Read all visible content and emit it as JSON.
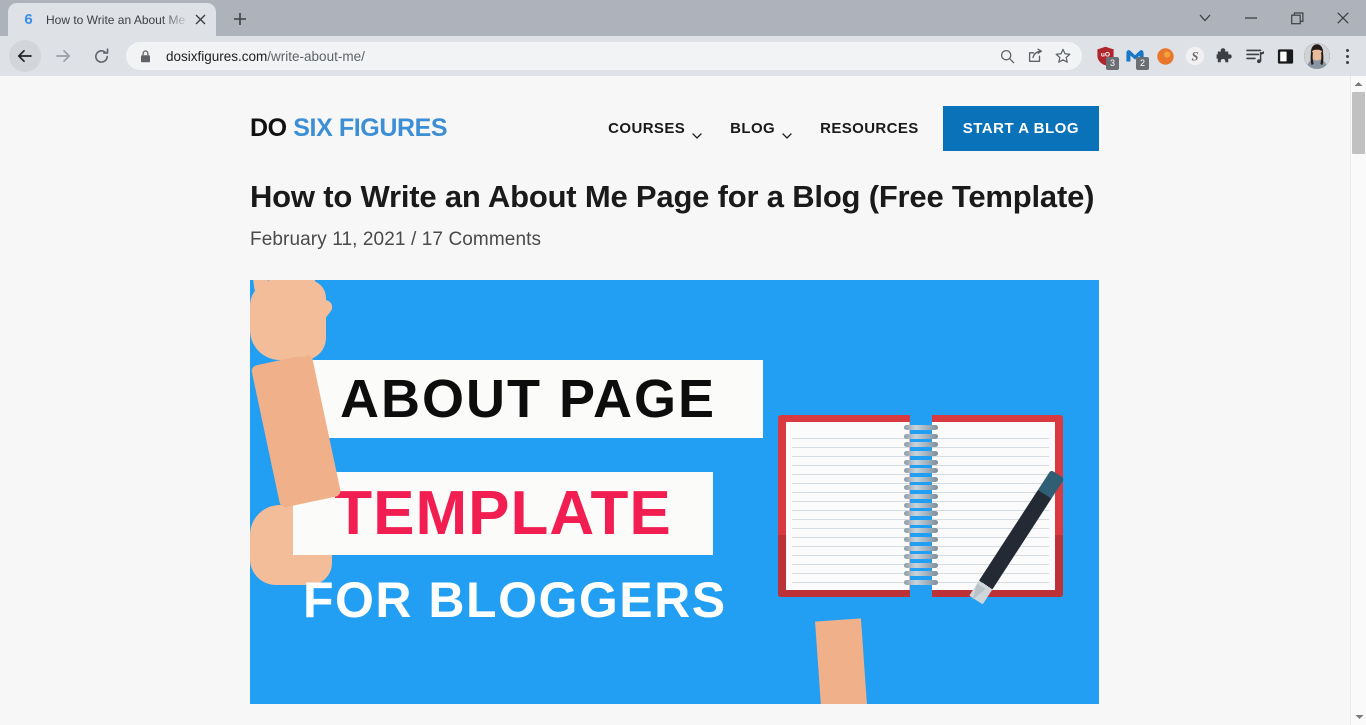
{
  "browser": {
    "tab": {
      "favicon_text": "6",
      "title": "How to Write an About Me Page",
      "close_label": "✕"
    },
    "new_tab_label": "+",
    "window_controls": {
      "tab_search": "tab-search-chevron",
      "minimize": "—",
      "maximize": "maximize-square",
      "close": "✕"
    },
    "nav": {
      "back": "back-arrow",
      "forward": "forward-arrow",
      "reload": "reload-arrow"
    },
    "omnibox": {
      "lock": "site-lock",
      "url_domain": "dosixfigures.com",
      "url_path": "/write-about-me/",
      "search_icon": "search-magnifier",
      "share_icon": "share-arrow",
      "bookmark_icon": "bookmark-star"
    },
    "extensions": [
      {
        "name": "ublock-origin",
        "glyph": "uO",
        "badge": "3",
        "color": "#b1262c"
      },
      {
        "name": "malwarebytes",
        "glyph": "M",
        "badge": "2",
        "color": "#1877c9"
      },
      {
        "name": "orange-dot-extension",
        "glyph": "",
        "badge": "",
        "color": "#e8762c"
      },
      {
        "name": "s-extension",
        "glyph": "S",
        "badge": "",
        "color": "#6b6b6b"
      },
      {
        "name": "extensions-puzzle",
        "glyph": "",
        "badge": "",
        "color": "#3c4043"
      },
      {
        "name": "reading-list",
        "glyph": "",
        "badge": "",
        "color": "#3c4043"
      },
      {
        "name": "side-panel",
        "glyph": "",
        "badge": "",
        "color": "#1a1a1a"
      }
    ],
    "profile": {
      "name": "profile-avatar"
    },
    "menu": "chrome-menu-dots"
  },
  "site": {
    "logo": {
      "part1": "DO",
      "part2": "SIX FIGURES"
    },
    "nav_items": [
      {
        "label": "COURSES",
        "has_chevron": true
      },
      {
        "label": "BLOG",
        "has_chevron": true
      },
      {
        "label": "RESOURCES",
        "has_chevron": false
      }
    ],
    "cta_label": "START A BLOG",
    "cta_color": "#0a72b9",
    "post": {
      "title": "How to Write an About Me Page for a Blog (Free Template)",
      "date": "February 11, 2021",
      "meta_separator": "/",
      "comments": "17 Comments"
    },
    "featured_image": {
      "background_color": "#229ff2",
      "line1": "ABOUT PAGE",
      "line1_color": "#0d0d0d",
      "line2": "TEMPLATE",
      "line2_color": "#f21e52",
      "line3": "FOR BLOGGERS",
      "line3_color": "#ffffff",
      "illustration": "open-spiral-notebook-with-hands-writing"
    }
  },
  "scrollbar": {
    "up_arrow": "scroll-up",
    "down_arrow": "scroll-down"
  }
}
